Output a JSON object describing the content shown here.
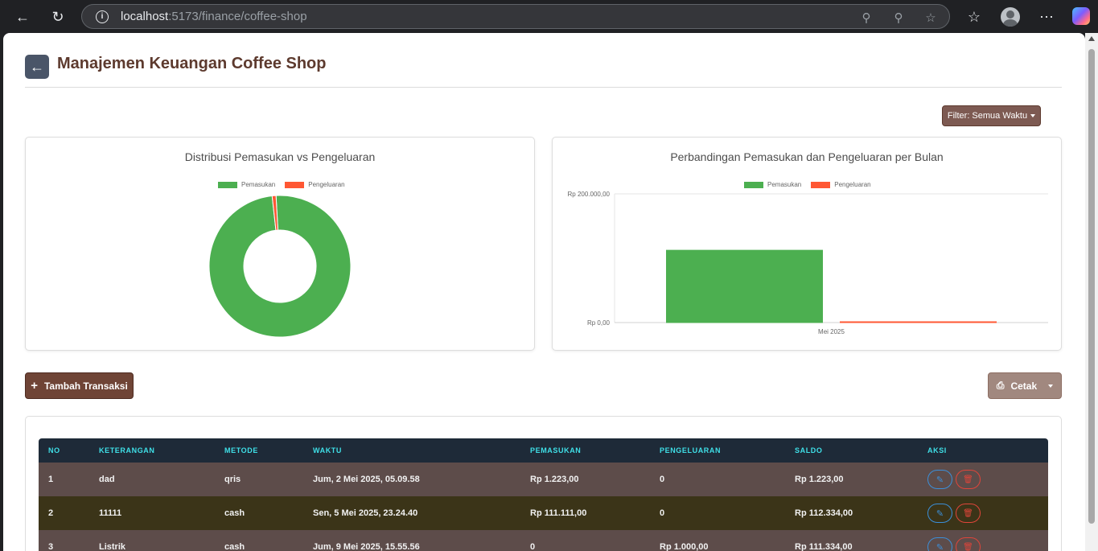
{
  "browser": {
    "url_host": "localhost",
    "url_path": ":5173/finance/coffee-shop"
  },
  "page": {
    "title": "Manajemen Keuangan Coffee Shop",
    "filter_label": "Filter: Semua Waktu",
    "add_button_label": "Tambah Transaksi",
    "print_button_label": "Cetak"
  },
  "pie_chart": {
    "title": "Distribusi Pemasukan vs Pengeluaran",
    "legend": [
      "Pemasukan",
      "Pengeluaran"
    ]
  },
  "bar_chart": {
    "title": "Perbandingan Pemasukan dan Pengeluaran per Bulan",
    "legend": [
      "Pemasukan",
      "Pengeluaran"
    ],
    "y_ticks": [
      "Rp 200.000,00",
      "Rp 0,00"
    ],
    "x_label": "Mei 2025"
  },
  "chart_data": [
    {
      "type": "pie",
      "title": "Distribusi Pemasukan vs Pengeluaran",
      "categories": [
        "Pemasukan",
        "Pengeluaran"
      ],
      "values": [
        112334,
        1000
      ],
      "colors": [
        "#4caf50",
        "#ff5733"
      ],
      "donut": true,
      "legend": "top"
    },
    {
      "type": "bar",
      "title": "Perbandingan Pemasukan dan Pengeluaran per Bulan",
      "categories": [
        "Mei 2025"
      ],
      "series": [
        {
          "name": "Pemasukan",
          "values": [
            112334
          ],
          "color": "#4caf50"
        },
        {
          "name": "Pengeluaran",
          "values": [
            1000
          ],
          "color": "#ff5733"
        }
      ],
      "ylim": [
        0,
        200000
      ],
      "y_ticks": [
        "Rp 200.000,00",
        "Rp 0,00"
      ],
      "grid": true,
      "legend": "top"
    }
  ],
  "table": {
    "headers": [
      "NO",
      "KETERANGAN",
      "METODE",
      "WAKTU",
      "PEMASUKAN",
      "PENGELUARAN",
      "SALDO",
      "AKSI"
    ],
    "rows": [
      {
        "no": "1",
        "keterangan": "dad",
        "metode": "qris",
        "waktu": "Jum, 2 Mei 2025, 05.09.58",
        "pemasukan": "Rp 1.223,00",
        "pengeluaran": "0",
        "saldo": "Rp 1.223,00",
        "color": "#5d4c4a"
      },
      {
        "no": "2",
        "keterangan": "11111",
        "metode": "cash",
        "waktu": "Sen, 5 Mei 2025, 23.24.40",
        "pemasukan": "Rp 111.111,00",
        "pengeluaran": "0",
        "saldo": "Rp 112.334,00",
        "color": "#3b3418"
      },
      {
        "no": "3",
        "keterangan": "Listrik",
        "metode": "cash",
        "waktu": "Jum, 9 Mei 2025, 15.55.56",
        "pemasukan": "0",
        "pengeluaran": "Rp 1.000,00",
        "saldo": "Rp 111.334,00",
        "color": "#5d4c4a"
      }
    ]
  }
}
